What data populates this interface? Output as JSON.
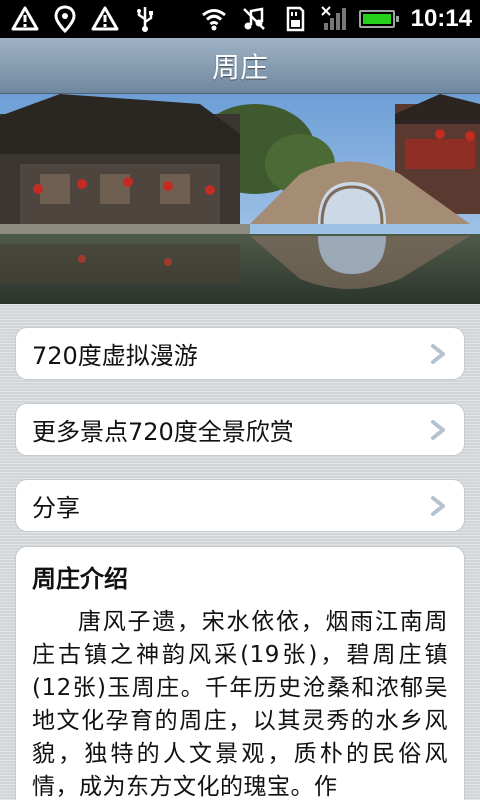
{
  "status_bar": {
    "time": "10:14",
    "icons": [
      "warning-icon",
      "location-pin-icon",
      "warning-icon",
      "usb-icon",
      "wifi-icon",
      "music-off-icon",
      "sd-card-icon",
      "signal-icon",
      "battery-icon"
    ]
  },
  "header": {
    "title": "周庄"
  },
  "hero": {
    "description_icon": "water-town-photo"
  },
  "menu": {
    "items": [
      {
        "label": "720度虚拟漫游"
      },
      {
        "label": "更多景点720度全景欣赏"
      },
      {
        "label": "分享"
      }
    ]
  },
  "intro": {
    "title": "周庄介绍",
    "text": "唐风子遗，宋水依依，烟雨江南周庄古镇之神韵风采(19张)，碧周庄镇(12张)玉周庄。千年历史沧桑和浓郁吴地文化孕育的周庄，以其灵秀的水乡风貌，独特的人文景观，质朴的民俗风情，成为东方文化的瑰宝。作"
  },
  "colors": {
    "title_bar_top": "#9fb2c4",
    "title_bar_bottom": "#6f889f",
    "background": "#d9dcdf",
    "card": "#ffffff",
    "battery_fill": "#26d11b"
  }
}
